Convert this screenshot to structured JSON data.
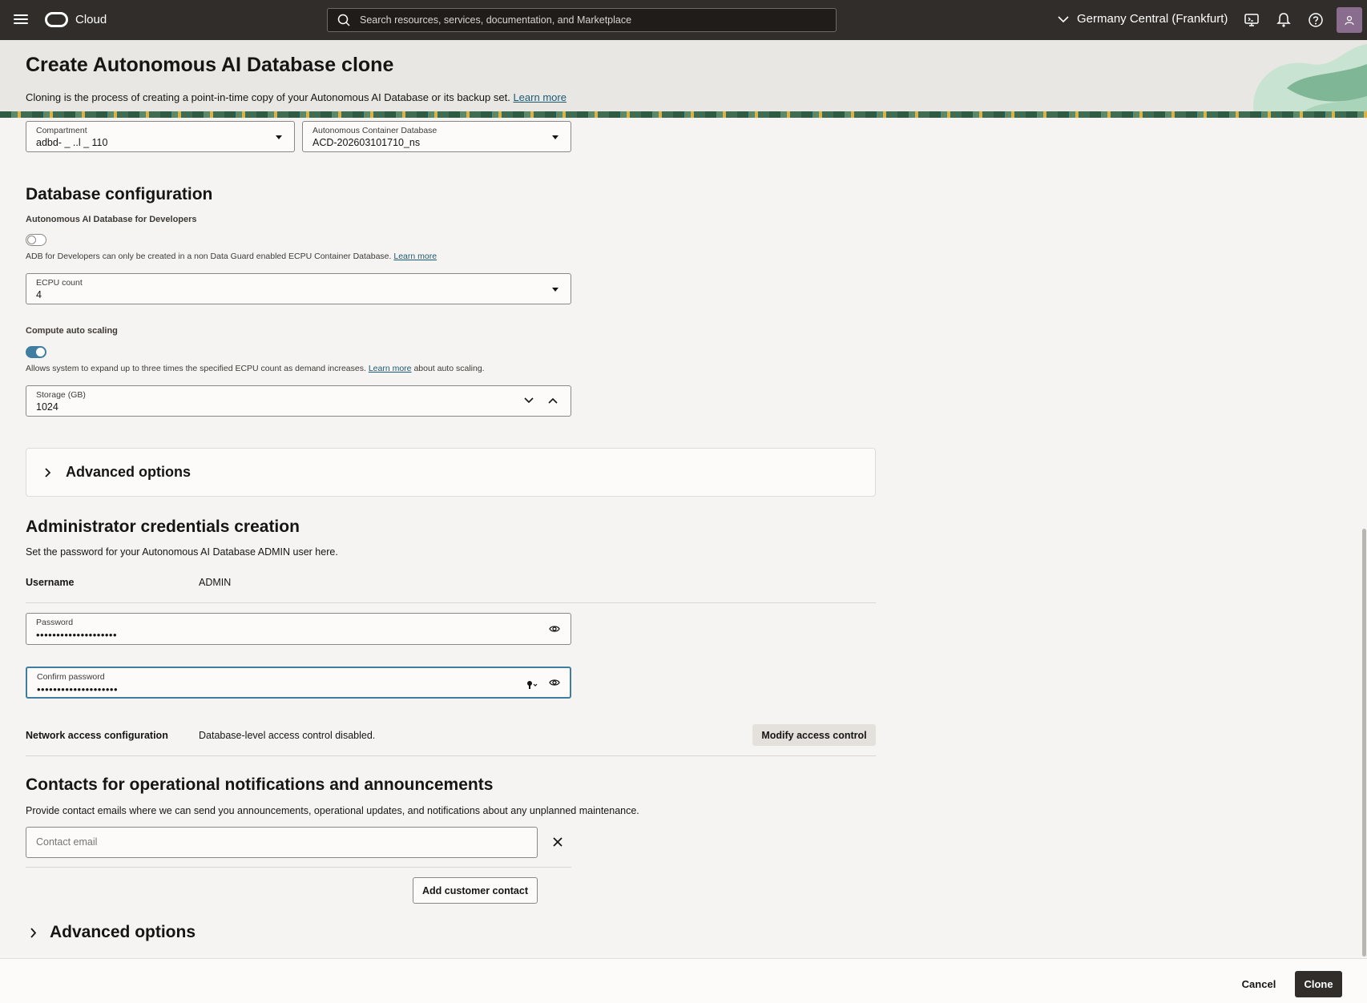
{
  "topbar": {
    "brand": "Cloud",
    "search_placeholder": "Search resources, services, documentation, and Marketplace",
    "region": "Germany Central (Frankfurt)"
  },
  "header": {
    "title": "Create Autonomous AI Database clone",
    "description": "Cloning is the process of creating a point-in-time copy of your Autonomous AI Database or its backup set.",
    "learn_more": "Learn more"
  },
  "placement": {
    "compartment": {
      "label": "Compartment",
      "value": "adbd-                _ ..l               _             110"
    },
    "container_db": {
      "label": "Autonomous Container Database",
      "value": "ACD-202603101710_ns"
    }
  },
  "db_config": {
    "title": "Database configuration",
    "developers_label": "Autonomous AI Database for Developers",
    "developers_enabled": false,
    "developers_helper": "ADB for Developers can only be created in a non Data Guard enabled ECPU Container Database.",
    "developers_learn_more": "Learn more",
    "ecpu": {
      "label": "ECPU count",
      "value": "4"
    },
    "autoscaling_label": "Compute auto scaling",
    "autoscaling_enabled": true,
    "autoscaling_helper_pre": "Allows system to expand up to three times the specified ECPU count as demand increases.",
    "autoscaling_learn_more": "Learn more",
    "autoscaling_helper_post": "about auto scaling.",
    "storage": {
      "label": "Storage (GB)",
      "value": "1024"
    },
    "advanced_options": "Advanced options"
  },
  "admin": {
    "title": "Administrator credentials creation",
    "description": "Set the password for your Autonomous AI Database ADMIN user here.",
    "username_label": "Username",
    "username_value": "ADMIN",
    "password": {
      "label": "Password",
      "value": "••••••••••••••••••••"
    },
    "confirm_password": {
      "label": "Confirm password",
      "value": "••••••••••••••••••••"
    },
    "network_label": "Network access configuration",
    "network_value": "Database-level access control disabled.",
    "modify_button": "Modify access control"
  },
  "contacts": {
    "title": "Contacts for operational notifications and announcements",
    "description": "Provide contact emails where we can send you announcements, operational updates, and notifications about any unplanned maintenance.",
    "email_placeholder": "Contact email",
    "add_button": "Add customer contact"
  },
  "advanced_options_bottom": "Advanced options",
  "footer": {
    "cancel": "Cancel",
    "clone": "Clone"
  },
  "colors": {
    "topbar": "#312d2a",
    "accent": "#3f7ea0",
    "link": "#1c5a73",
    "primary_button": "#312d2a"
  }
}
